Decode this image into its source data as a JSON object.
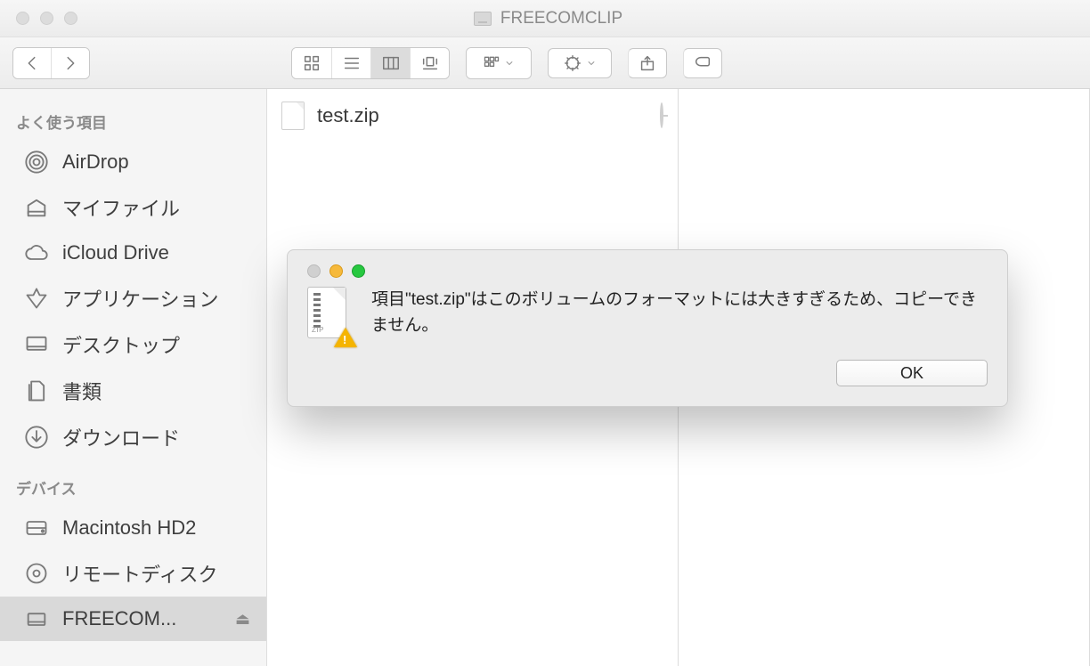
{
  "window": {
    "title": "FREECOMCLIP"
  },
  "sidebar": {
    "sections": [
      {
        "label": "よく使う項目",
        "items": [
          {
            "icon": "airdrop",
            "label": "AirDrop"
          },
          {
            "icon": "myfiles",
            "label": "マイファイル"
          },
          {
            "icon": "icloud",
            "label": "iCloud Drive"
          },
          {
            "icon": "apps",
            "label": "アプリケーション"
          },
          {
            "icon": "desktop",
            "label": "デスクトップ"
          },
          {
            "icon": "documents",
            "label": "書類"
          },
          {
            "icon": "downloads",
            "label": "ダウンロード"
          }
        ]
      },
      {
        "label": "デバイス",
        "items": [
          {
            "icon": "hdd",
            "label": "Macintosh HD2"
          },
          {
            "icon": "optical",
            "label": "リモートディスク"
          },
          {
            "icon": "ext-drive",
            "label": "FREECOM...",
            "ejectable": true,
            "selected": true
          }
        ]
      }
    ]
  },
  "files": {
    "col0": [
      {
        "name": "test.zip"
      }
    ]
  },
  "dialog": {
    "message": "項目\"test.zip\"はこのボリュームのフォーマットには大きすぎるため、コピーできません。",
    "ok": "OK",
    "zip_label": "ZIP"
  }
}
